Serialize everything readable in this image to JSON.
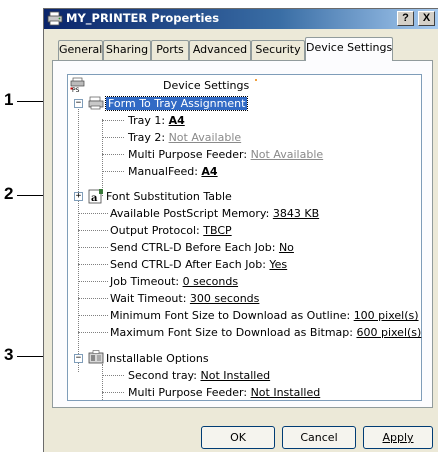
{
  "window": {
    "title": "MY_PRINTER Properties",
    "help_label": "?",
    "close_label": "X"
  },
  "tabs": [
    {
      "label": "General"
    },
    {
      "label": "Sharing"
    },
    {
      "label": "Ports"
    },
    {
      "label": "Advanced"
    },
    {
      "label": "Security"
    },
    {
      "label": "Device Settings",
      "active": true
    }
  ],
  "tree": {
    "root": "Device Settings",
    "form_to_tray": "Form To Tray Assignment",
    "tray1": {
      "label": "Tray 1:",
      "value": "A4"
    },
    "tray2": {
      "label": "Tray 2:",
      "value": "Not Available"
    },
    "mpf": {
      "label": "Multi Purpose Feeder:",
      "value": "Not Available"
    },
    "manual": {
      "label": "ManualFeed:",
      "value": "A4"
    },
    "font_sub": "Font Substitution Table",
    "ps_memory": {
      "label": "Available PostScript Memory:",
      "value": "3843 KB"
    },
    "protocol": {
      "label": "Output Protocol:",
      "value": "TBCP"
    },
    "ctrl_before": {
      "label": "Send CTRL-D Before Each Job:",
      "value": "No"
    },
    "ctrl_after": {
      "label": "Send CTRL-D After Each Job:",
      "value": "Yes"
    },
    "job_timeout": {
      "label": "Job Timeout:",
      "value": "0 seconds"
    },
    "wait_timeout": {
      "label": "Wait Timeout:",
      "value": "300 seconds"
    },
    "min_font": {
      "label": "Minimum Font Size to Download as Outline:",
      "value": "100 pixel(s)"
    },
    "max_font": {
      "label": "Maximum Font Size to Download as Bitmap:",
      "value": "600 pixel(s)"
    },
    "installable": "Installable Options",
    "second_tray": {
      "label": "Second tray:",
      "value": "Not Installed"
    },
    "opt_mpf": {
      "label": "Multi Purpose Feeder:",
      "value": "Not Installed"
    }
  },
  "buttons": {
    "ok": "OK",
    "cancel": "Cancel",
    "apply": "Apply"
  },
  "callouts": [
    "1",
    "2",
    "3"
  ],
  "icons": {
    "title": "printer-icon",
    "root": "ps-printer-icon",
    "form_to_tray": "tray-icon",
    "font_sub": "font-icon",
    "installable": "options-icon"
  },
  "colors": {
    "titlebar": "#0a246a",
    "selection": "#316ac5",
    "window": "#ece9d8"
  }
}
